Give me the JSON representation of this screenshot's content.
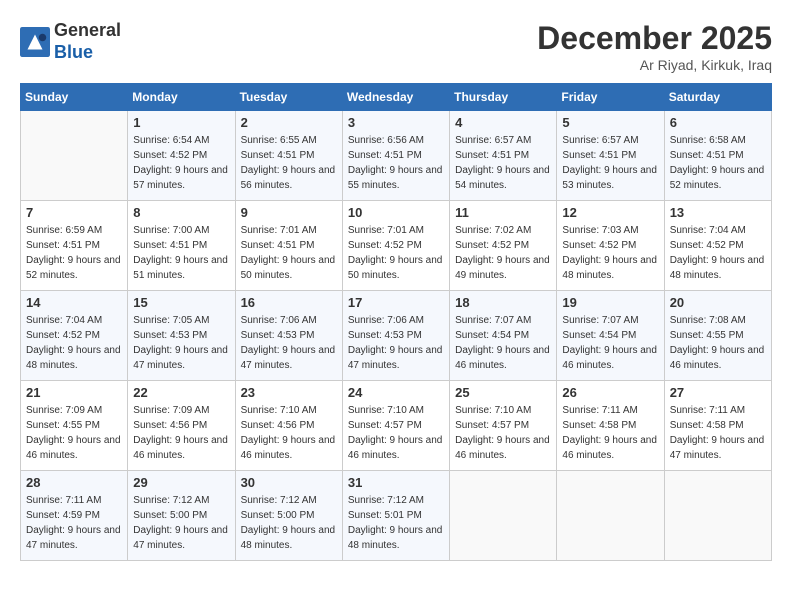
{
  "header": {
    "logo_line1": "General",
    "logo_line2": "Blue",
    "month_title": "December 2025",
    "subtitle": "Ar Riyad, Kirkuk, Iraq"
  },
  "days_of_week": [
    "Sunday",
    "Monday",
    "Tuesday",
    "Wednesday",
    "Thursday",
    "Friday",
    "Saturday"
  ],
  "weeks": [
    [
      {
        "day": "",
        "sunrise": "",
        "sunset": "",
        "daylight": ""
      },
      {
        "day": "1",
        "sunrise": "6:54 AM",
        "sunset": "4:52 PM",
        "daylight": "9 hours and 57 minutes."
      },
      {
        "day": "2",
        "sunrise": "6:55 AM",
        "sunset": "4:51 PM",
        "daylight": "9 hours and 56 minutes."
      },
      {
        "day": "3",
        "sunrise": "6:56 AM",
        "sunset": "4:51 PM",
        "daylight": "9 hours and 55 minutes."
      },
      {
        "day": "4",
        "sunrise": "6:57 AM",
        "sunset": "4:51 PM",
        "daylight": "9 hours and 54 minutes."
      },
      {
        "day": "5",
        "sunrise": "6:57 AM",
        "sunset": "4:51 PM",
        "daylight": "9 hours and 53 minutes."
      },
      {
        "day": "6",
        "sunrise": "6:58 AM",
        "sunset": "4:51 PM",
        "daylight": "9 hours and 52 minutes."
      }
    ],
    [
      {
        "day": "7",
        "sunrise": "6:59 AM",
        "sunset": "4:51 PM",
        "daylight": "9 hours and 52 minutes."
      },
      {
        "day": "8",
        "sunrise": "7:00 AM",
        "sunset": "4:51 PM",
        "daylight": "9 hours and 51 minutes."
      },
      {
        "day": "9",
        "sunrise": "7:01 AM",
        "sunset": "4:51 PM",
        "daylight": "9 hours and 50 minutes."
      },
      {
        "day": "10",
        "sunrise": "7:01 AM",
        "sunset": "4:52 PM",
        "daylight": "9 hours and 50 minutes."
      },
      {
        "day": "11",
        "sunrise": "7:02 AM",
        "sunset": "4:52 PM",
        "daylight": "9 hours and 49 minutes."
      },
      {
        "day": "12",
        "sunrise": "7:03 AM",
        "sunset": "4:52 PM",
        "daylight": "9 hours and 48 minutes."
      },
      {
        "day": "13",
        "sunrise": "7:04 AM",
        "sunset": "4:52 PM",
        "daylight": "9 hours and 48 minutes."
      }
    ],
    [
      {
        "day": "14",
        "sunrise": "7:04 AM",
        "sunset": "4:52 PM",
        "daylight": "9 hours and 48 minutes."
      },
      {
        "day": "15",
        "sunrise": "7:05 AM",
        "sunset": "4:53 PM",
        "daylight": "9 hours and 47 minutes."
      },
      {
        "day": "16",
        "sunrise": "7:06 AM",
        "sunset": "4:53 PM",
        "daylight": "9 hours and 47 minutes."
      },
      {
        "day": "17",
        "sunrise": "7:06 AM",
        "sunset": "4:53 PM",
        "daylight": "9 hours and 47 minutes."
      },
      {
        "day": "18",
        "sunrise": "7:07 AM",
        "sunset": "4:54 PM",
        "daylight": "9 hours and 46 minutes."
      },
      {
        "day": "19",
        "sunrise": "7:07 AM",
        "sunset": "4:54 PM",
        "daylight": "9 hours and 46 minutes."
      },
      {
        "day": "20",
        "sunrise": "7:08 AM",
        "sunset": "4:55 PM",
        "daylight": "9 hours and 46 minutes."
      }
    ],
    [
      {
        "day": "21",
        "sunrise": "7:09 AM",
        "sunset": "4:55 PM",
        "daylight": "9 hours and 46 minutes."
      },
      {
        "day": "22",
        "sunrise": "7:09 AM",
        "sunset": "4:56 PM",
        "daylight": "9 hours and 46 minutes."
      },
      {
        "day": "23",
        "sunrise": "7:10 AM",
        "sunset": "4:56 PM",
        "daylight": "9 hours and 46 minutes."
      },
      {
        "day": "24",
        "sunrise": "7:10 AM",
        "sunset": "4:57 PM",
        "daylight": "9 hours and 46 minutes."
      },
      {
        "day": "25",
        "sunrise": "7:10 AM",
        "sunset": "4:57 PM",
        "daylight": "9 hours and 46 minutes."
      },
      {
        "day": "26",
        "sunrise": "7:11 AM",
        "sunset": "4:58 PM",
        "daylight": "9 hours and 46 minutes."
      },
      {
        "day": "27",
        "sunrise": "7:11 AM",
        "sunset": "4:58 PM",
        "daylight": "9 hours and 47 minutes."
      }
    ],
    [
      {
        "day": "28",
        "sunrise": "7:11 AM",
        "sunset": "4:59 PM",
        "daylight": "9 hours and 47 minutes."
      },
      {
        "day": "29",
        "sunrise": "7:12 AM",
        "sunset": "5:00 PM",
        "daylight": "9 hours and 47 minutes."
      },
      {
        "day": "30",
        "sunrise": "7:12 AM",
        "sunset": "5:00 PM",
        "daylight": "9 hours and 48 minutes."
      },
      {
        "day": "31",
        "sunrise": "7:12 AM",
        "sunset": "5:01 PM",
        "daylight": "9 hours and 48 minutes."
      },
      {
        "day": "",
        "sunrise": "",
        "sunset": "",
        "daylight": ""
      },
      {
        "day": "",
        "sunrise": "",
        "sunset": "",
        "daylight": ""
      },
      {
        "day": "",
        "sunrise": "",
        "sunset": "",
        "daylight": ""
      }
    ]
  ]
}
